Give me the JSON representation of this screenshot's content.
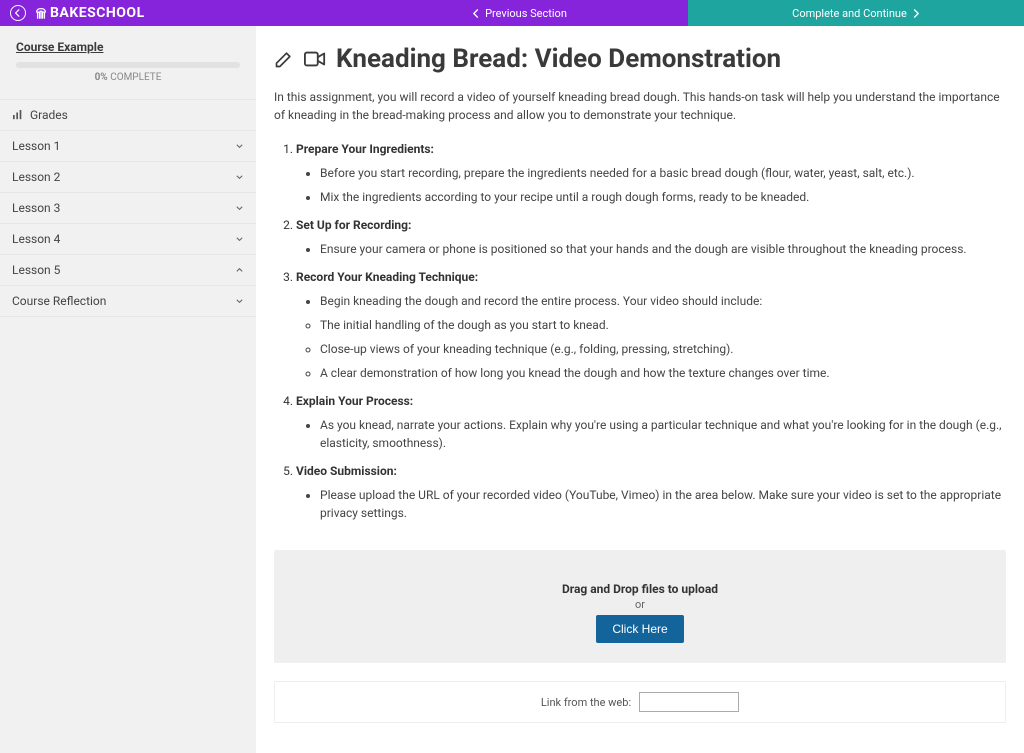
{
  "brand": "BAKESCHOOL",
  "nav": {
    "prev": "Previous Section",
    "next": "Complete and Continue"
  },
  "sidebar": {
    "course_link": "Course Example",
    "progress_pct": "0%",
    "progress_word": "COMPLETE",
    "items": [
      {
        "label": "Grades",
        "icon": "grades",
        "expandable": false
      },
      {
        "label": "Lesson 1",
        "expandable": true,
        "open": false
      },
      {
        "label": "Lesson 2",
        "expandable": true,
        "open": false
      },
      {
        "label": "Lesson 3",
        "expandable": true,
        "open": false
      },
      {
        "label": "Lesson 4",
        "expandable": true,
        "open": false
      },
      {
        "label": "Lesson 5",
        "expandable": true,
        "open": true
      },
      {
        "label": "Course Reflection",
        "expandable": true,
        "open": false
      }
    ]
  },
  "page": {
    "title": "Kneading Bread: Video Demonstration",
    "intro": "In this assignment, you will record a video of yourself kneading bread dough. This hands-on task will help you understand the importance of kneading in the bread-making process and allow you to demonstrate your technique.",
    "steps": [
      {
        "title": "Prepare Your Ingredients:",
        "bullets": [
          "Before you start recording, prepare the ingredients needed for a basic bread dough (flour, water, yeast, salt, etc.).",
          "Mix the ingredients according to your recipe until a rough dough forms, ready to be kneaded."
        ]
      },
      {
        "title": "Set Up for Recording:",
        "bullets": [
          "Ensure your camera or phone is positioned so that your hands and the dough are visible throughout the kneading process."
        ]
      },
      {
        "title": "Record Your Kneading Technique:",
        "bullets": [
          "Begin kneading the dough and record the entire process. Your video should include:"
        ],
        "sub_bullets": [
          "The initial handling of the dough as you start to knead.",
          "Close-up views of your kneading technique (e.g., folding, pressing, stretching).",
          "A clear demonstration of how long you knead the dough and how the texture changes over time."
        ]
      },
      {
        "title": "Explain Your Process:",
        "bullets": [
          "As you knead, narrate your actions. Explain why you're using a particular technique and what you're looking for in the dough (e.g., elasticity, smoothness)."
        ]
      },
      {
        "title": "Video Submission:",
        "bullets": [
          "Please upload the URL of your recorded video (YouTube, Vimeo) in the area below. Make sure your video is set to the appropriate privacy settings."
        ]
      }
    ],
    "upload": {
      "title": "Drag and Drop files to upload",
      "or": "or",
      "button": "Click Here",
      "link_label": "Link from the web:"
    }
  }
}
